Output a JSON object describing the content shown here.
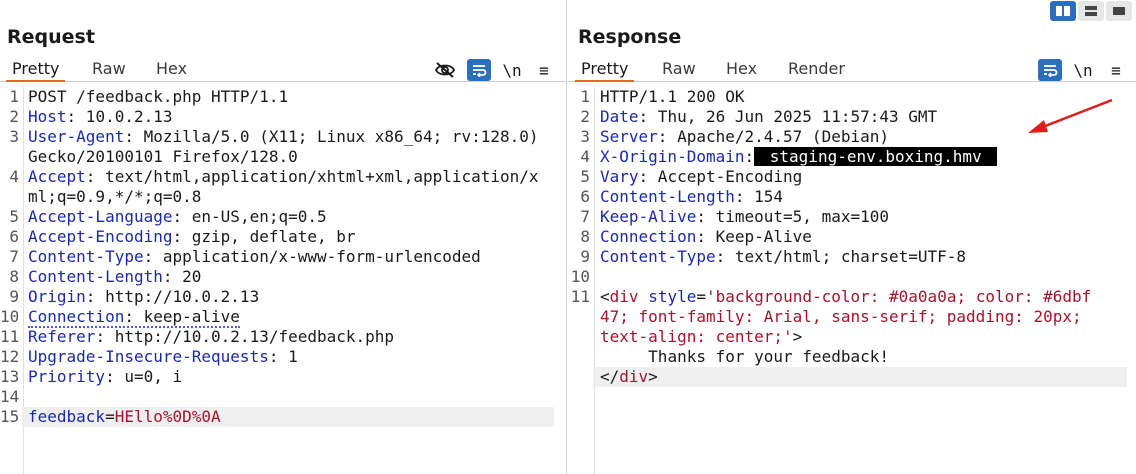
{
  "layout_controls": [
    {
      "name": "side-by-side",
      "active": true
    },
    {
      "name": "top-bottom",
      "active": false
    },
    {
      "name": "single",
      "active": false
    }
  ],
  "request": {
    "title": "Request",
    "tabs": [
      "Pretty",
      "Raw",
      "Hex"
    ],
    "active_tab": "Pretty",
    "tools": {
      "newline_label": "\\n",
      "menu_label": "≡"
    },
    "lines": {
      "l1": {
        "n": "1",
        "text": "POST /feedback.php HTTP/1.1"
      },
      "l2": {
        "n": "2",
        "key": "Host",
        "val": " 10.0.2.13"
      },
      "l3": {
        "n": "3",
        "key": "User-Agent",
        "val": " Mozilla/5.0 (X11; Linux x86_64; rv:128.0) Gecko/20100101 Firefox/128.0"
      },
      "l4": {
        "n": "4",
        "key": "Accept",
        "val": " text/html,application/xhtml+xml,application/xml;q=0.9,*/*;q=0.8"
      },
      "l5": {
        "n": "5",
        "key": "Accept-Language",
        "val": " en-US,en;q=0.5"
      },
      "l6": {
        "n": "6",
        "key": "Accept-Encoding",
        "val": " gzip, deflate, br"
      },
      "l7": {
        "n": "7",
        "key": "Content-Type",
        "val": " application/x-www-form-urlencoded"
      },
      "l8": {
        "n": "8",
        "key": "Content-Length",
        "val": " 20"
      },
      "l9": {
        "n": "9",
        "key": "Origin",
        "val": " http://10.0.2.13"
      },
      "l10": {
        "n": "10",
        "key": "Connection",
        "val": " keep-alive"
      },
      "l11": {
        "n": "11",
        "key": "Referer",
        "val": " http://10.0.2.13/feedback.php"
      },
      "l12": {
        "n": "12",
        "key": "Upgrade-Insecure-Requests",
        "val": " 1"
      },
      "l13": {
        "n": "13",
        "key": "Priority",
        "val": " u=0, i"
      },
      "l14": {
        "n": "14"
      },
      "l15": {
        "n": "15",
        "param": "feedback",
        "value": "HEllo%0D%0A"
      }
    }
  },
  "response": {
    "title": "Response",
    "tabs": [
      "Pretty",
      "Raw",
      "Hex",
      "Render"
    ],
    "active_tab": "Pretty",
    "tools": {
      "newline_label": "\\n",
      "menu_label": "≡"
    },
    "lines": {
      "l1": {
        "n": "1",
        "text": "HTTP/1.1 200 OK"
      },
      "l2": {
        "n": "2",
        "key": "Date",
        "val": " Thu, 26 Jun 2025 11:57:43 GMT"
      },
      "l3": {
        "n": "3",
        "key": "Server",
        "val": " Apache/2.4.57 (Debian)"
      },
      "l4": {
        "n": "4",
        "key": "X-Origin-Domain",
        "val": " staging-env.boxing.hmv "
      },
      "l5": {
        "n": "5",
        "key": "Vary",
        "val": " Accept-Encoding"
      },
      "l6": {
        "n": "6",
        "key": "Content-Length",
        "val": " 154"
      },
      "l7": {
        "n": "7",
        "key": "Keep-Alive",
        "val": " timeout=5, max=100"
      },
      "l8": {
        "n": "8",
        "key": "Connection",
        "val": " Keep-Alive"
      },
      "l9": {
        "n": "9",
        "key": "Content-Type",
        "val": " text/html; charset=UTF-8"
      },
      "l10": {
        "n": "10"
      },
      "l11": {
        "n": "11",
        "open": "<",
        "tag": "div",
        "attr": "style",
        "eq": "=",
        "str": "'background-color: #0a0a0a; color: #6dbf47; font-family: Arial, sans-serif; padding: 20px; text-align: center;'",
        "close": ">",
        "body": "     Thanks for your feedback!",
        "end_open": "</",
        "end_tag": "div",
        "end_close": ">"
      }
    }
  },
  "colors": {
    "accent": "#e8642c",
    "active_button": "#2b6ebc",
    "header_key": "#1c2aa8",
    "string_value": "#a3152b",
    "arrow": "#e31b1b"
  }
}
